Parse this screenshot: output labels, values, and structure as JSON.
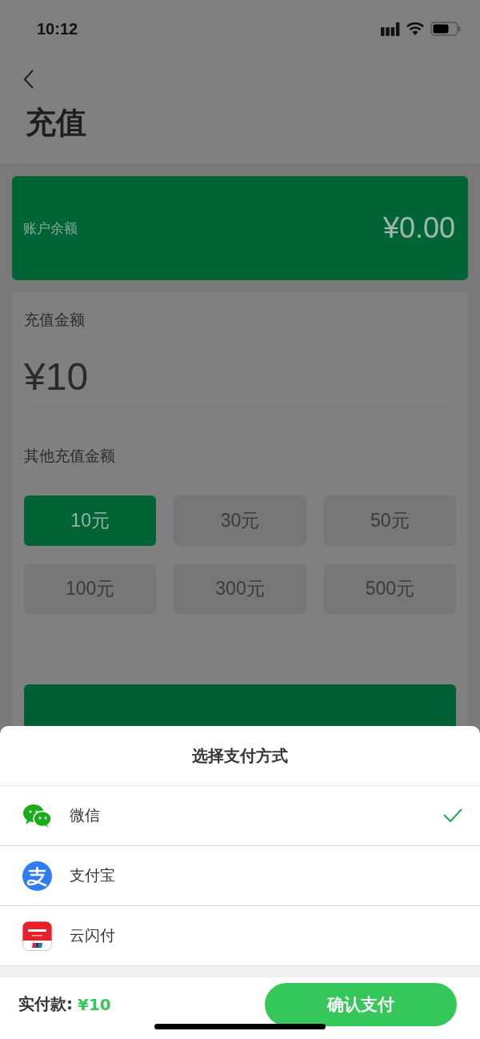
{
  "status_bar": {
    "time": "10:12"
  },
  "nav": {
    "title": "充值"
  },
  "balance": {
    "label": "账户余额",
    "amount": "¥0.00"
  },
  "recharge": {
    "label": "充值金额",
    "amount": "¥10",
    "other_label": "其他充值金额",
    "options": [
      {
        "label": "10元",
        "selected": true
      },
      {
        "label": "30元",
        "selected": false
      },
      {
        "label": "50元",
        "selected": false
      },
      {
        "label": "100元",
        "selected": false
      },
      {
        "label": "300元",
        "selected": false
      },
      {
        "label": "500元",
        "selected": false
      }
    ]
  },
  "payment_sheet": {
    "title": "选择支付方式",
    "methods": [
      {
        "name": "微信",
        "kind": "wechat",
        "selected": true
      },
      {
        "name": "支付宝",
        "kind": "alipay",
        "selected": false
      },
      {
        "name": "云闪付",
        "kind": "unionpay",
        "selected": false
      }
    ],
    "total_label": "实付款:",
    "total": "¥10",
    "confirm": "确认支付"
  }
}
